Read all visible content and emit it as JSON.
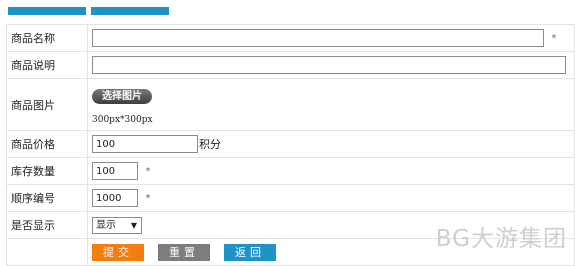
{
  "tabs": [
    {
      "label": ""
    },
    {
      "label": ""
    }
  ],
  "form": {
    "name": {
      "label": "商品名称",
      "value": "",
      "required_mark": "*"
    },
    "desc": {
      "label": "商品说明",
      "value": ""
    },
    "image": {
      "label": "商品图片",
      "button": "选择图片",
      "hint": "300px*300px"
    },
    "price": {
      "label": "商品价格",
      "value": "100",
      "unit": "积分"
    },
    "stock": {
      "label": "库存数量",
      "value": "100",
      "required_mark": "*"
    },
    "order": {
      "label": "顺序编号",
      "value": "1000",
      "required_mark": "*"
    },
    "display": {
      "label": "是否显示",
      "selected": "显示"
    }
  },
  "actions": {
    "submit": "提交",
    "reset": "重置",
    "back": "返回"
  },
  "watermark": "BG大游集团",
  "colors": {
    "tab": "#1f93c6",
    "submit": "#f47d12",
    "reset": "#7d7d7d",
    "back": "#1f93c6"
  }
}
